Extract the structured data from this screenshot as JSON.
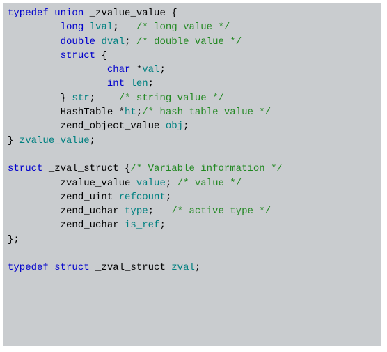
{
  "code": {
    "t": [
      {
        "c": "kw",
        "s": "typedef"
      },
      {
        "c": "",
        "s": " "
      },
      {
        "c": "kw",
        "s": "union"
      },
      {
        "c": "",
        "s": " _zvalue_value {\n"
      },
      {
        "c": "",
        "s": "         "
      },
      {
        "c": "kw",
        "s": "long"
      },
      {
        "c": "",
        "s": " "
      },
      {
        "c": "ident",
        "s": "lval"
      },
      {
        "c": "",
        "s": ";   "
      },
      {
        "c": "cmt",
        "s": "/* long value */"
      },
      {
        "c": "",
        "s": "\n"
      },
      {
        "c": "",
        "s": "         "
      },
      {
        "c": "kw",
        "s": "double"
      },
      {
        "c": "",
        "s": " "
      },
      {
        "c": "ident",
        "s": "dval"
      },
      {
        "c": "",
        "s": "; "
      },
      {
        "c": "cmt",
        "s": "/* double value */"
      },
      {
        "c": "",
        "s": "\n"
      },
      {
        "c": "",
        "s": "         "
      },
      {
        "c": "kw",
        "s": "struct"
      },
      {
        "c": "",
        "s": " {\n"
      },
      {
        "c": "",
        "s": "                 "
      },
      {
        "c": "kw",
        "s": "char"
      },
      {
        "c": "",
        "s": " *"
      },
      {
        "c": "ident",
        "s": "val"
      },
      {
        "c": "",
        "s": ";\n"
      },
      {
        "c": "",
        "s": "                 "
      },
      {
        "c": "kw",
        "s": "int"
      },
      {
        "c": "",
        "s": " "
      },
      {
        "c": "ident",
        "s": "len"
      },
      {
        "c": "",
        "s": ";\n"
      },
      {
        "c": "",
        "s": "         } "
      },
      {
        "c": "ident",
        "s": "str"
      },
      {
        "c": "",
        "s": ";    "
      },
      {
        "c": "cmt",
        "s": "/* string value */"
      },
      {
        "c": "",
        "s": "\n"
      },
      {
        "c": "",
        "s": "         HashTable *"
      },
      {
        "c": "ident",
        "s": "ht"
      },
      {
        "c": "",
        "s": ";"
      },
      {
        "c": "cmt",
        "s": "/* hash table value */"
      },
      {
        "c": "",
        "s": "\n"
      },
      {
        "c": "",
        "s": "         zend_object_value "
      },
      {
        "c": "ident",
        "s": "obj"
      },
      {
        "c": "",
        "s": ";\n"
      },
      {
        "c": "",
        "s": "} "
      },
      {
        "c": "ident",
        "s": "zvalue_value"
      },
      {
        "c": "",
        "s": ";\n"
      },
      {
        "c": "",
        "s": "\n"
      },
      {
        "c": "kw",
        "s": "struct"
      },
      {
        "c": "",
        "s": " _zval_struct {"
      },
      {
        "c": "cmt",
        "s": "/* Variable information */"
      },
      {
        "c": "",
        "s": "\n"
      },
      {
        "c": "",
        "s": "         zvalue_value "
      },
      {
        "c": "ident",
        "s": "value"
      },
      {
        "c": "",
        "s": "; "
      },
      {
        "c": "cmt",
        "s": "/* value */"
      },
      {
        "c": "",
        "s": "\n"
      },
      {
        "c": "",
        "s": "         zend_uint "
      },
      {
        "c": "ident",
        "s": "refcount"
      },
      {
        "c": "",
        "s": ";\n"
      },
      {
        "c": "",
        "s": "         zend_uchar "
      },
      {
        "c": "ident",
        "s": "type"
      },
      {
        "c": "",
        "s": ";   "
      },
      {
        "c": "cmt",
        "s": "/* active type */"
      },
      {
        "c": "",
        "s": "\n"
      },
      {
        "c": "",
        "s": "         zend_uchar "
      },
      {
        "c": "ident",
        "s": "is_ref"
      },
      {
        "c": "",
        "s": ";\n"
      },
      {
        "c": "",
        "s": "};\n"
      },
      {
        "c": "",
        "s": "\n"
      },
      {
        "c": "kw",
        "s": "typedef"
      },
      {
        "c": "",
        "s": " "
      },
      {
        "c": "kw",
        "s": "struct"
      },
      {
        "c": "",
        "s": " _zval_struct "
      },
      {
        "c": "ident",
        "s": "zval"
      },
      {
        "c": "",
        "s": ";\n"
      }
    ]
  }
}
